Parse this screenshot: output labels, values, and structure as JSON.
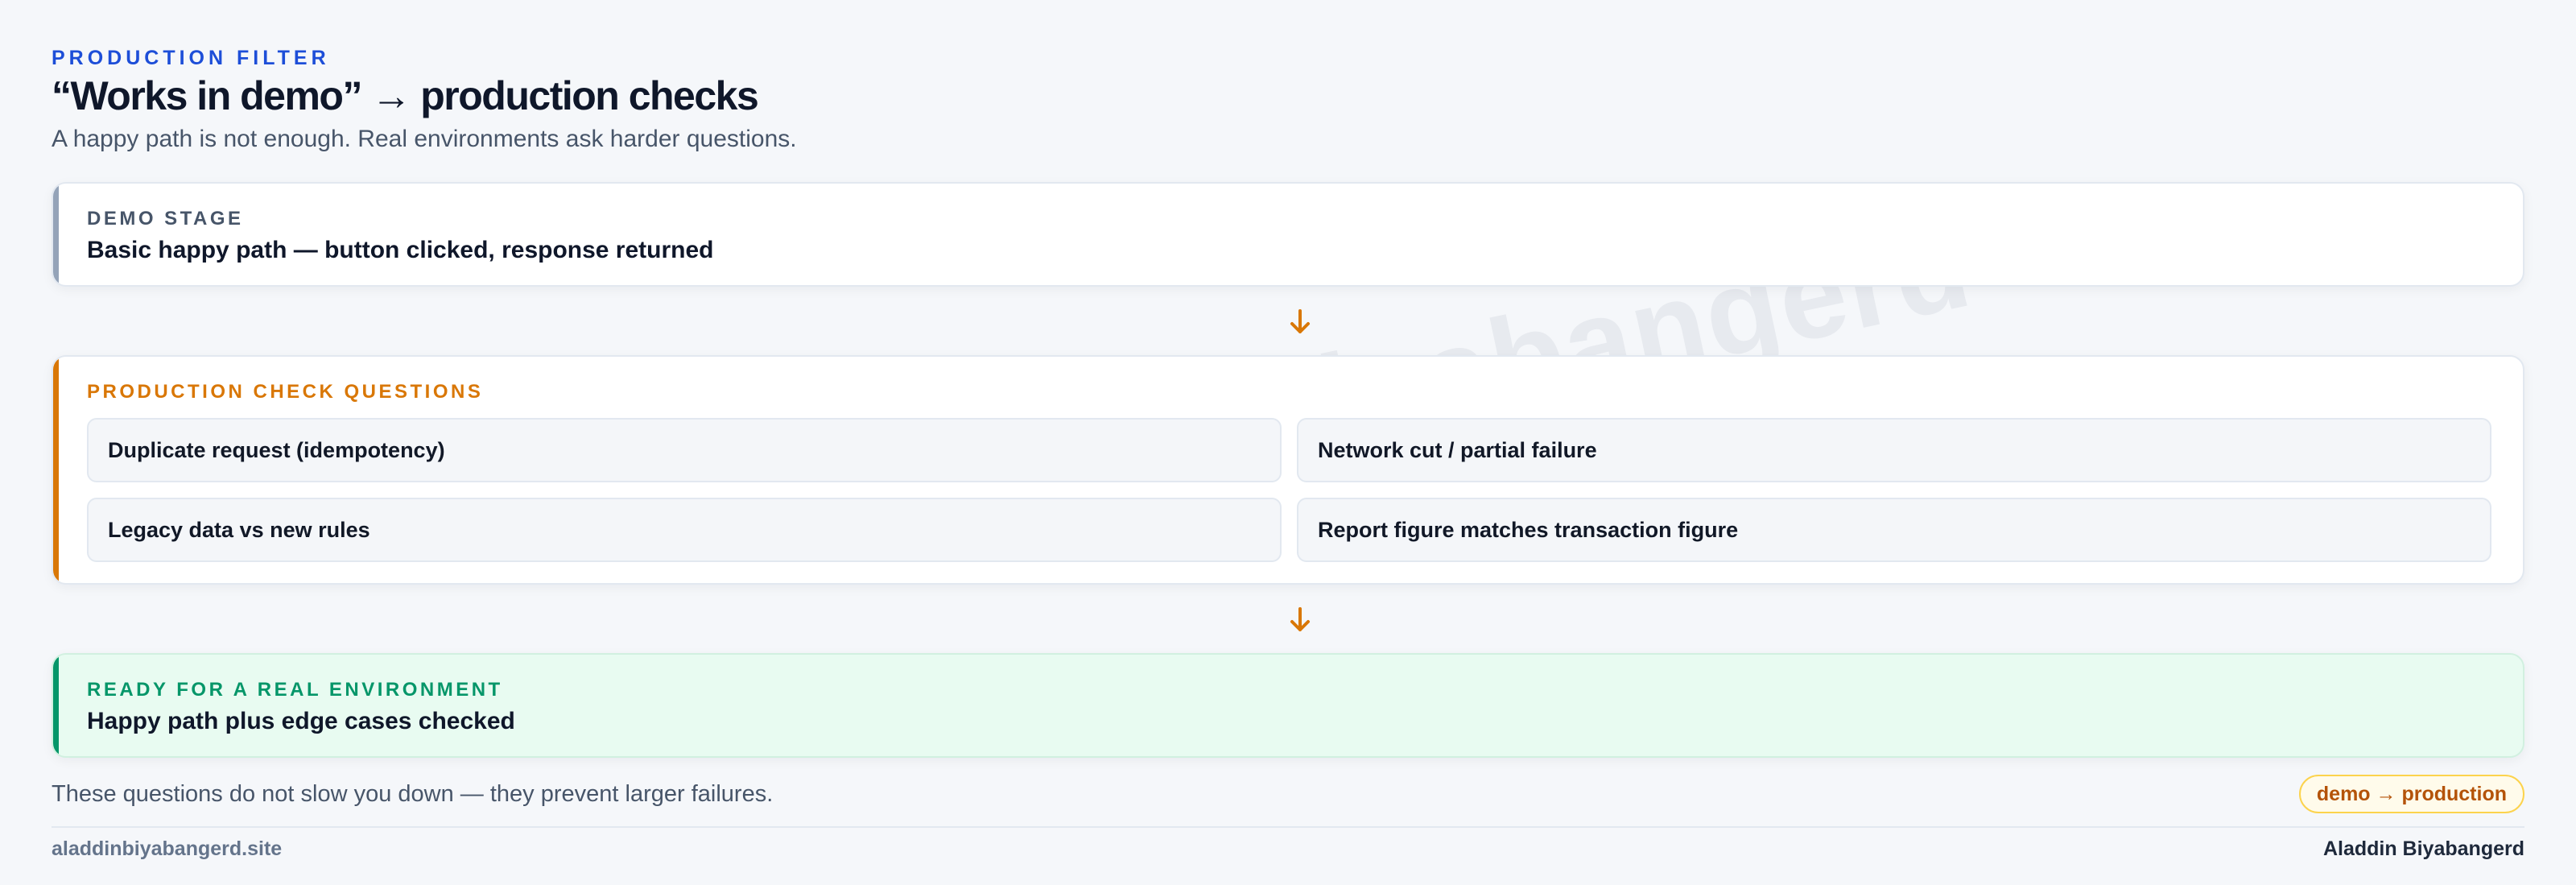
{
  "header": {
    "eyebrow": "PRODUCTION FILTER",
    "title": "“Works in demo” → production checks",
    "subtitle": "A happy path is not enough. Real environments ask harder questions."
  },
  "demo_stage": {
    "label": "DEMO STAGE",
    "text": "Basic happy path — button clicked, response returned"
  },
  "production_checks": {
    "label": "PRODUCTION CHECK QUESTIONS",
    "items": [
      "Duplicate request (idempotency)",
      "Network cut / partial failure",
      "Legacy data vs new rules",
      "Report figure matches transaction figure"
    ]
  },
  "ready": {
    "label": "READY FOR A REAL ENVIRONMENT",
    "text": "Happy path plus edge cases checked"
  },
  "footer": {
    "note": "These questions do not slow you down — they prevent larger failures.",
    "badge": "demo → production",
    "site": "aladdinbiyabangerd.site",
    "author": "Aladdin Biyabangerd"
  },
  "watermark": "Aladdin Biyabangerd",
  "colors": {
    "accent_blue": "#1d4ed8",
    "demo_gray": "#94a3b8",
    "check_amber": "#d97706",
    "ready_green": "#059669",
    "ready_bg": "#e8fbf1"
  },
  "icons": {
    "flow_arrow": "arrow-down-icon"
  }
}
